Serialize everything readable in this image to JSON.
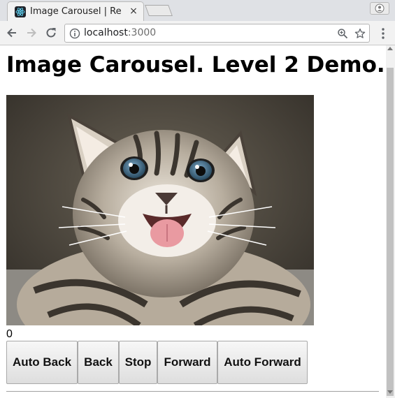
{
  "browser": {
    "tab_title": "Image Carousel | Re",
    "tab_close": "×",
    "url_host": "localhost",
    "url_port": ":3000"
  },
  "page": {
    "title": "Image Carousel. Level 2 Demo.",
    "current_index": "0",
    "image_subject": "kitten",
    "buttons": {
      "auto_back": "Auto Back",
      "back": "Back",
      "stop": "Stop",
      "forward": "Forward",
      "auto_forward": "Auto Forward"
    }
  },
  "colors": {
    "react_logo": "#61dafb",
    "favicon_bg": "#20232a"
  }
}
